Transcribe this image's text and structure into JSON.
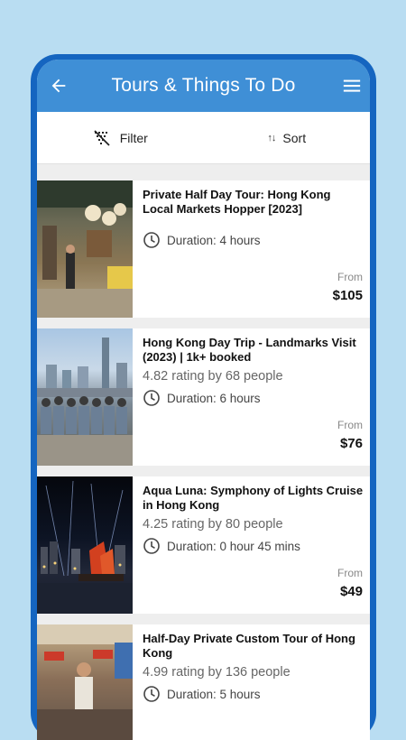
{
  "header": {
    "title": "Tours & Things To Do",
    "back_icon": "arrow-left-icon",
    "menu_icon": "hamburger-menu-icon"
  },
  "toolbar": {
    "filter_label": "Filter",
    "sort_label": "Sort",
    "sort_icon_glyph": "↑↓"
  },
  "tours": [
    {
      "title": "Private Half Day Tour: Hong Kong Local Markets Hopper [2023]",
      "rating": "",
      "duration": "Duration: 4 hours",
      "from": "From",
      "price": "$105"
    },
    {
      "title": "Hong Kong Day Trip - Landmarks Visit (2023) | 1k+ booked",
      "rating": "4.82 rating by 68 people",
      "duration": "Duration: 6 hours",
      "from": "From",
      "price": "$76"
    },
    {
      "title": "Aqua Luna: Symphony of Lights Cruise in Hong Kong",
      "rating": "4.25 rating by 80 people",
      "duration": "Duration: 0 hour 45 mins",
      "from": "From",
      "price": "$49"
    },
    {
      "title": "Half-Day Private Custom Tour of Hong Kong",
      "rating": "4.99 rating by 136 people",
      "duration": "Duration: 5 hours",
      "from": "",
      "price": ""
    }
  ],
  "colors": {
    "background": "#b9ddf2",
    "phone_frame": "#1565c0",
    "app_bar": "#3f8fd6"
  }
}
